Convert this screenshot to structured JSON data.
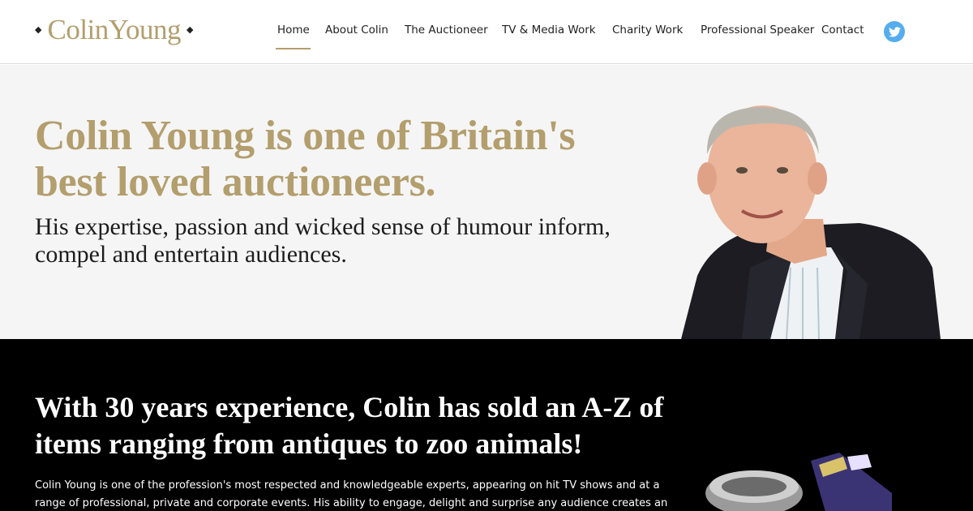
{
  "logo": {
    "text": "ColinYoung",
    "dot": "◆"
  },
  "nav": {
    "items": [
      {
        "label": "Home",
        "active": true
      },
      {
        "label": "About Colin"
      },
      {
        "label": "The Auctioneer"
      },
      {
        "label": "TV & Media Work"
      },
      {
        "label": "Charity Work"
      },
      {
        "label": "Professional Speaker"
      },
      {
        "label": "Contact"
      }
    ],
    "social_icon": "twitter-icon"
  },
  "hero": {
    "title": "Colin Young is one of Britain's best loved auctioneers.",
    "subtitle": "His expertise, passion and wicked sense of humour inform, compel and entertain audiences."
  },
  "intro": {
    "title": "With 30 years experience, Colin has sold an A-Z of items ranging from antiques to zoo animals!",
    "body": "Colin Young is one of the profession's most respected and knowledgeable experts, appearing on hit TV shows and at a range of professional, private and corporate events. His ability to engage, delight and surprise any audience creates an excellent auction"
  },
  "colors": {
    "accent": "#b39e6d",
    "twitter": "#55acee",
    "hero_bg": "#f5f5f5",
    "dark_bg": "#000000"
  }
}
